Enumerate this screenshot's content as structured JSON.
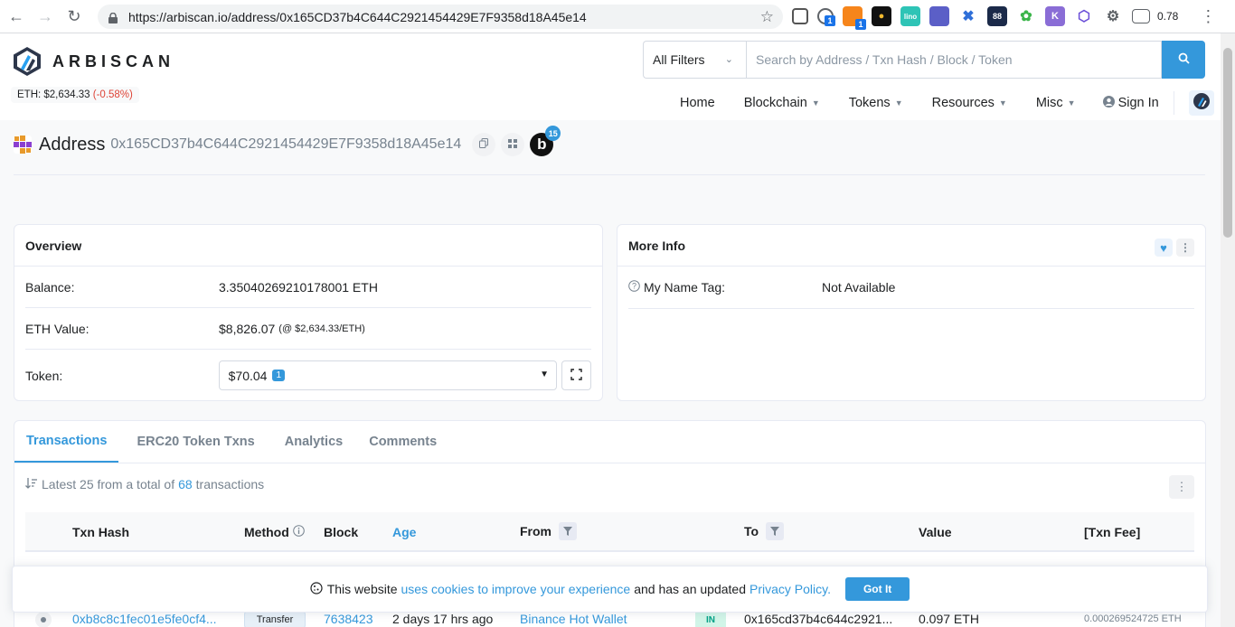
{
  "browser": {
    "url": "https://arbiscan.io/address/0x165CD37b4C644C2921454429E7F9358d18A45e14",
    "ext_value": "0.78",
    "ext_badge_1": "1",
    "ext_badge_2": "1"
  },
  "header": {
    "logo_text": "ARBISCAN",
    "eth_price_label": "ETH: $2,634.33",
    "eth_price_change": "(-0.58%)",
    "filter_label": "All Filters",
    "search_placeholder": "Search by Address / Txn Hash / Block / Token",
    "nav": [
      "Home",
      "Blockchain",
      "Tokens",
      "Resources",
      "Misc"
    ],
    "signin": "Sign In"
  },
  "address": {
    "title": "Address",
    "hash": "0x165CD37b4C644C2921454429E7F9358d18A45e14",
    "badge_count": "15"
  },
  "overview": {
    "title": "Overview",
    "balance_label": "Balance:",
    "balance_value": "3.35040269210178001 ETH",
    "eth_value_label": "ETH Value:",
    "eth_value": "$8,826.07",
    "eth_value_rate": "(@ $2,634.33/ETH)",
    "token_label": "Token:",
    "token_value": "$70.04",
    "token_count": "1"
  },
  "more_info": {
    "title": "More Info",
    "name_tag_label": "My Name Tag:",
    "name_tag_value": "Not Available"
  },
  "tabs": [
    "Transactions",
    "ERC20 Token Txns",
    "Analytics",
    "Comments"
  ],
  "tx": {
    "summary_prefix": "Latest 25 from a total of",
    "summary_count": "68",
    "summary_suffix": "transactions",
    "columns": {
      "hash": "Txn Hash",
      "method": "Method",
      "block": "Block",
      "age": "Age",
      "from": "From",
      "to": "To",
      "value": "Value",
      "fee": "[Txn Fee]"
    },
    "rows": [
      {
        "hash": "0xb8c8c1fec01e5fe0cf4...",
        "method": "Transfer",
        "block": "7638423",
        "age": "2 days 17 hrs ago",
        "from": "Binance Hot Wallet",
        "direction": "IN",
        "to": "0x165cd37b4c644c2921...",
        "value": "0.097 ETH",
        "fee": "0.000269524725 ETH"
      }
    ]
  },
  "cookie": {
    "prefix": "This website",
    "link1": "uses cookies to improve your experience",
    "middle": "and has an updated",
    "link2": "Privacy Policy.",
    "button": "Got It"
  },
  "colors": {
    "accent": "#3498db",
    "negative": "#de4437",
    "in_badge": "#00a186"
  }
}
